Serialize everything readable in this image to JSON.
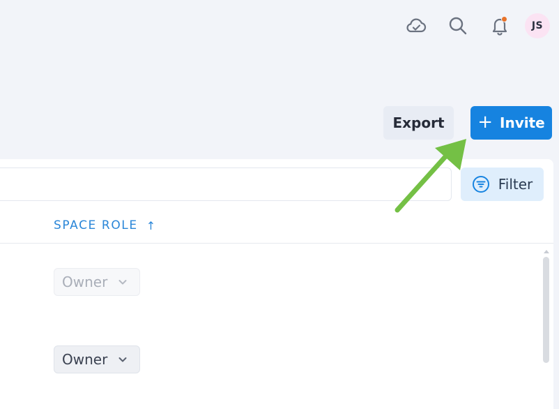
{
  "header": {
    "icons": [
      "cloud-check-icon",
      "search-icon",
      "bell-icon"
    ],
    "avatar_initials": "JS",
    "has_notification": true
  },
  "toolbar": {
    "export_label": "Export",
    "invite_label": "Invite",
    "invite_icon": "+"
  },
  "filter": {
    "label": "Filter",
    "search_value": ""
  },
  "table": {
    "columns": [
      {
        "label": "SPACE ROLE",
        "sort": "↑"
      }
    ],
    "rows": [
      {
        "role": "Owner",
        "disabled": true
      },
      {
        "role": "Owner",
        "disabled": false
      }
    ]
  },
  "colors": {
    "primary": "#1683e0",
    "accent_text": "#2a86d8",
    "annotation_arrow": "#74c045",
    "notification": "#e8732a"
  }
}
